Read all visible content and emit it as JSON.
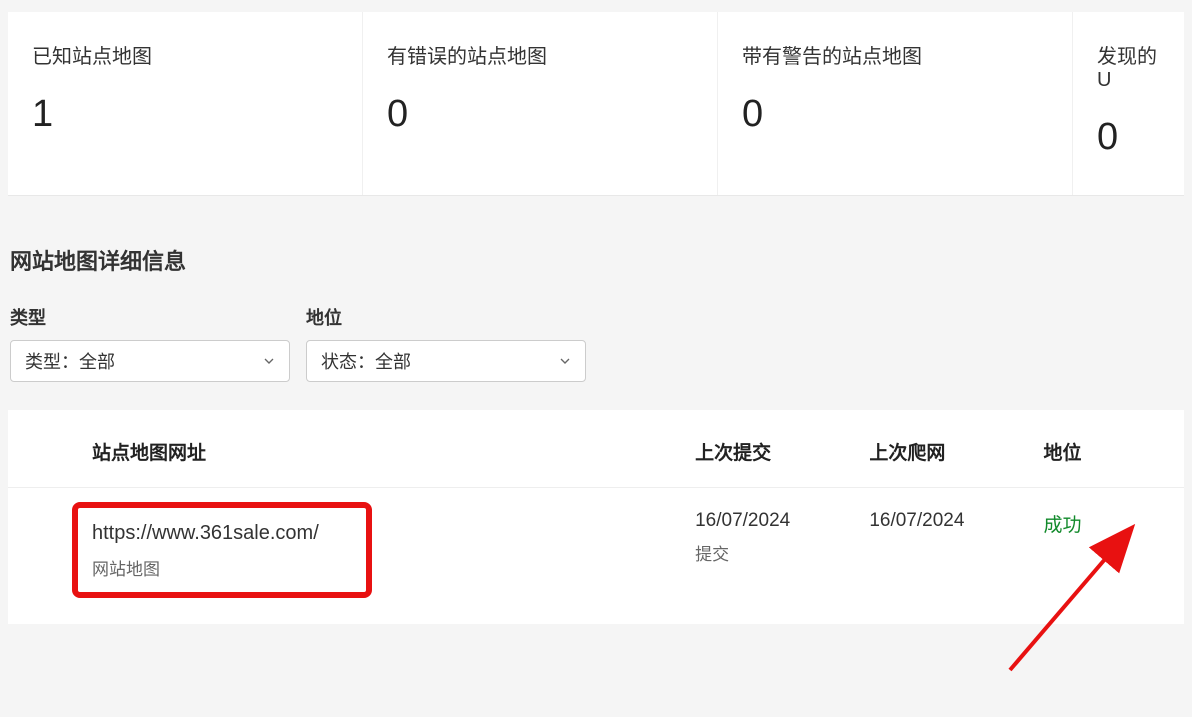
{
  "stats": {
    "known": {
      "label": "已知站点地图",
      "value": "1"
    },
    "errors": {
      "label": "有错误的站点地图",
      "value": "0"
    },
    "warnings": {
      "label": "带有警告的站点地图",
      "value": "0"
    },
    "discovered": {
      "label": "发现的 U",
      "value": "0"
    }
  },
  "section_title": "网站地图详细信息",
  "filters": {
    "type": {
      "label": "类型",
      "select_text": "类型：全部"
    },
    "status": {
      "label": "地位",
      "select_text": "状态：全部"
    }
  },
  "table": {
    "headers": {
      "url": "站点地图网址",
      "submitted": "上次提交",
      "crawled": "上次爬网",
      "status": "地位"
    },
    "rows": [
      {
        "url": "https://www.361sale.com/",
        "url_sub": "网站地图",
        "submitted_date": "16/07/2024",
        "submitted_sub": "提交",
        "crawled_date": "16/07/2024",
        "status": "成功"
      }
    ]
  }
}
